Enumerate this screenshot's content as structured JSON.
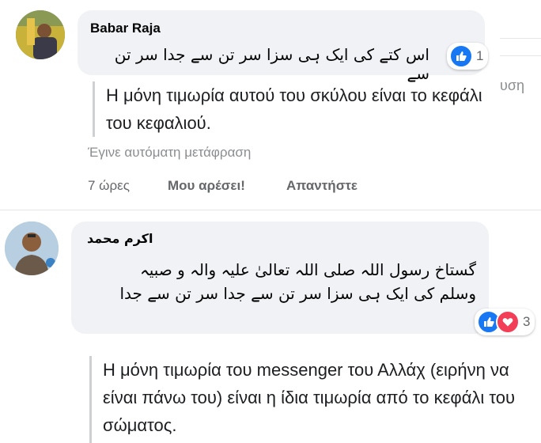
{
  "comments": [
    {
      "author": "Babar Raja",
      "text": "اس کتے کی ایک ہی سزا سر تن سے جدا سر تن سے",
      "reaction_count": "1",
      "translation": "Η μόνη τιμωρία αυτού του σκύλου είναι το κεφάλι του κεφαλιού.",
      "auto_translated_label": "Έγινε αυτόματη μετάφραση",
      "time": "7 ώρες",
      "like_label": "Μου αρέσει!",
      "reply_label": "Απαντήστε"
    },
    {
      "author": "اکرم محمد",
      "text": "گستاخ رسول اللہ صلی اللہ تعالیٰ علیہ والہ و صبیہ وسلم کی ایک ہی سزا سر تن سے جدا سر تن سے جدا",
      "reaction_count": "3",
      "translation": "Η μόνη τιμωρία του messenger του Αλλάχ (ειρήνη να είναι πάνω του) είναι η ίδια τιμωρία από το κεφάλι του σώματος."
    }
  ],
  "side_fragment": "υση",
  "colors": {
    "like_blue": "#1877f2",
    "love_red": "#f33e58",
    "bubble_bg": "#f0f2f5"
  }
}
